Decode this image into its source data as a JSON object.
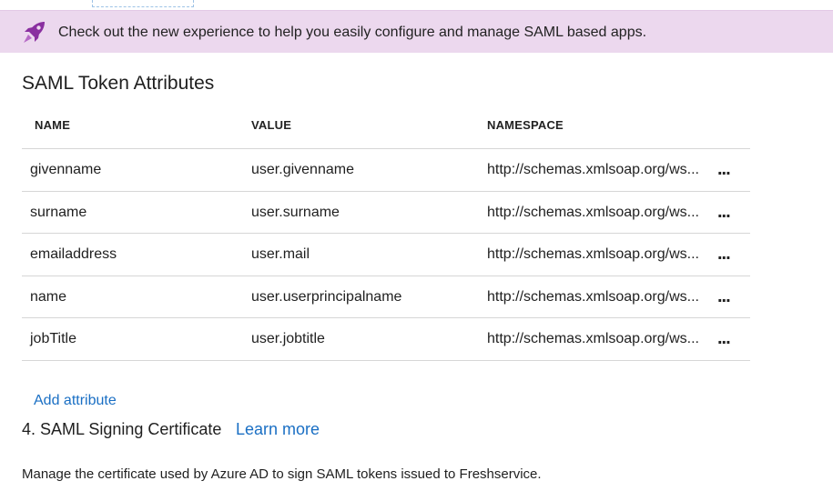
{
  "banner": {
    "icon": "rocket-icon",
    "accent_color": "#8a2fa0",
    "text": "Check out the new experience to help you easily configure and manage SAML based apps."
  },
  "attributes_section": {
    "title": "SAML Token Attributes",
    "columns": [
      "NAME",
      "VALUE",
      "NAMESPACE"
    ],
    "rows": [
      {
        "name": "givenname",
        "value": "user.givenname",
        "namespace": "http://schemas.xmlsoap.org/ws..."
      },
      {
        "name": "surname",
        "value": "user.surname",
        "namespace": "http://schemas.xmlsoap.org/ws..."
      },
      {
        "name": "emailaddress",
        "value": "user.mail",
        "namespace": "http://schemas.xmlsoap.org/ws..."
      },
      {
        "name": "name",
        "value": "user.userprincipalname",
        "namespace": "http://schemas.xmlsoap.org/ws..."
      },
      {
        "name": "jobTitle",
        "value": "user.jobtitle",
        "namespace": "http://schemas.xmlsoap.org/ws..."
      }
    ],
    "more_label": "...",
    "add_label": "Add attribute"
  },
  "certificate_section": {
    "title": "4. SAML Signing Certificate",
    "learn_more": "Learn more",
    "description": "Manage the certificate used by Azure AD to sign SAML tokens issued to Freshservice."
  },
  "colors": {
    "banner_bg": "#ecd8ee",
    "link": "#1a6fc4",
    "divider": "#d6d6d6"
  }
}
